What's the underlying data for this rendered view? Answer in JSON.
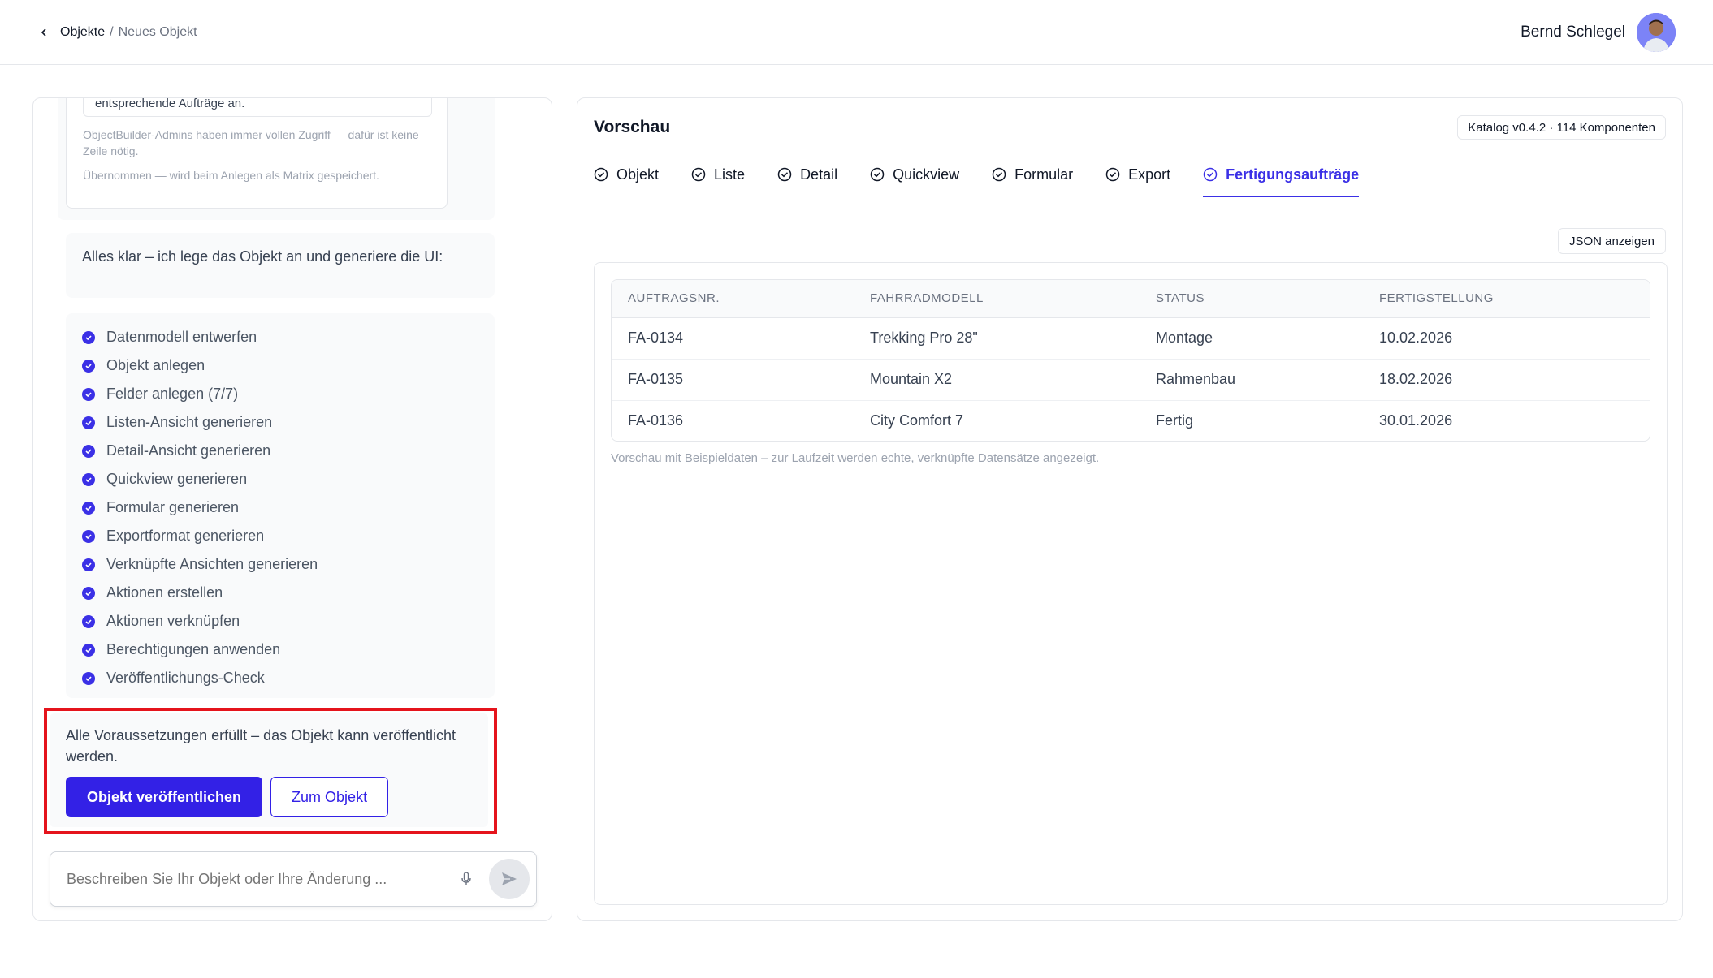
{
  "header": {
    "breadcrumb_root": "Objekte",
    "breadcrumb_sep": "/",
    "breadcrumb_current": "Neues Objekt",
    "user_name": "Bernd Schlegel"
  },
  "chat": {
    "perm_text": "entsprechende Aufträge an.",
    "perm_note_1": "ObjectBuilder-Admins haben immer vollen Zugriff — dafür ist keine Zeile nötig.",
    "perm_note_2": "Übernommen — wird beim Anlegen als Matrix gespeichert.",
    "message": "Alles klar – ich lege das Objekt an und generiere die UI:",
    "steps": [
      "Datenmodell entwerfen",
      "Objekt anlegen",
      "Felder anlegen (7/7)",
      "Listen-Ansicht generieren",
      "Detail-Ansicht generieren",
      "Quickview generieren",
      "Formular generieren",
      "Exportformat generieren",
      "Verknüpfte Ansichten generieren",
      "Aktionen erstellen",
      "Aktionen verknüpfen",
      "Berechtigungen anwenden",
      "Veröffentlichungs-Check"
    ],
    "publish_text": "Alle Voraussetzungen erfüllt – das Objekt kann veröffentlicht werden.",
    "publish_button": "Objekt veröffentlichen",
    "goto_button": "Zum Objekt",
    "composer_placeholder": "Beschreiben Sie Ihr Objekt oder Ihre Änderung ..."
  },
  "preview": {
    "title": "Vorschau",
    "catalog_badge": "Katalog v0.4.2 · 114 Komponenten",
    "tabs": [
      "Objekt",
      "Liste",
      "Detail",
      "Quickview",
      "Formular",
      "Export",
      "Fertigungsaufträge"
    ],
    "active_tab": "Fertigungsaufträge",
    "json_button": "JSON anzeigen",
    "table": {
      "columns": [
        "AUFTRAGSNR.",
        "FAHRRADMODELL",
        "STATUS",
        "FERTIGSTELLUNG"
      ],
      "rows": [
        [
          "FA-0134",
          "Trekking Pro 28\"",
          "Montage",
          "10.02.2026"
        ],
        [
          "FA-0135",
          "Mountain X2",
          "Rahmenbau",
          "18.02.2026"
        ],
        [
          "FA-0136",
          "City Comfort 7",
          "Fertig",
          "30.01.2026"
        ]
      ]
    },
    "note": "Vorschau mit Beispieldaten – zur Laufzeit werden echte, verknüpfte Datensätze angezeigt."
  },
  "colors": {
    "accent": "#3321e6",
    "highlight": "#e5141c"
  }
}
